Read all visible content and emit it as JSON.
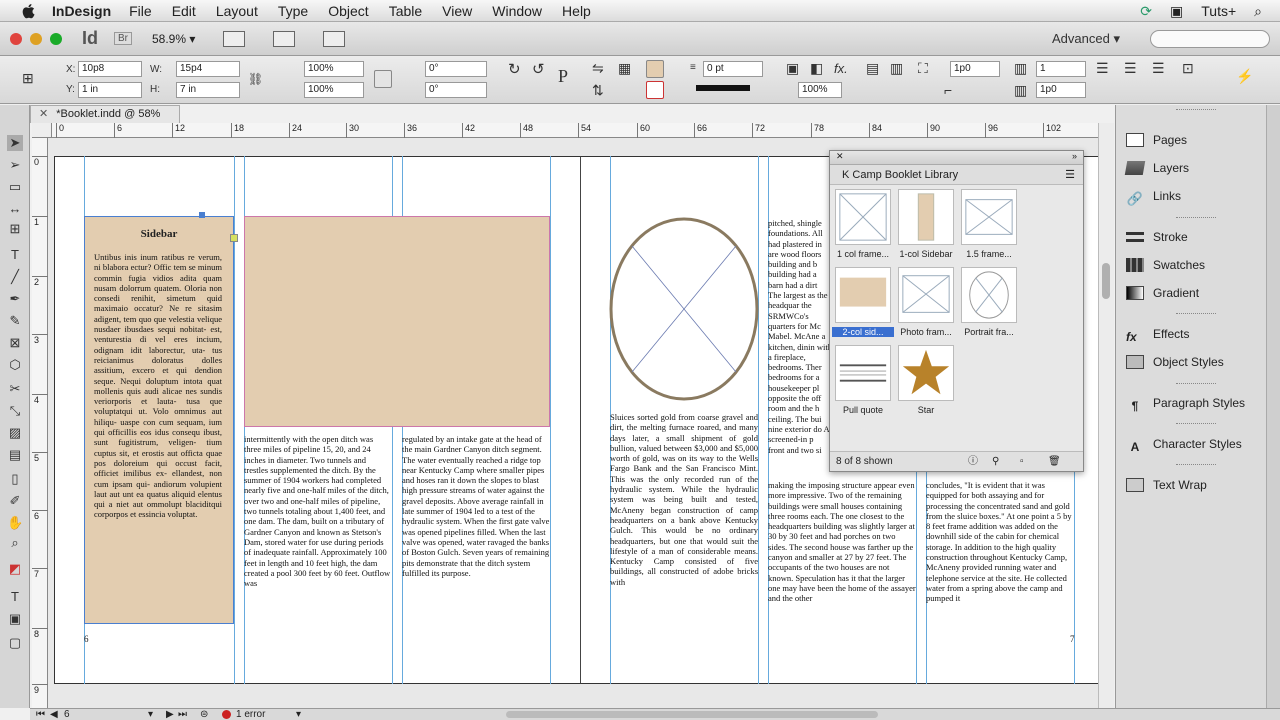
{
  "menubar": {
    "app_name": "InDesign",
    "items": [
      "File",
      "Edit",
      "Layout",
      "Type",
      "Object",
      "Table",
      "View",
      "Window",
      "Help"
    ],
    "right_label": "Tuts+"
  },
  "appbar": {
    "logo": "Id",
    "bridge": "Br",
    "zoom": "58.9%",
    "workspace": "Advanced"
  },
  "control": {
    "x": "10p8",
    "y": "1 in",
    "w": "15p4",
    "h": "7 in",
    "scale_x": "100%",
    "scale_y": "100%",
    "rotate": "0°",
    "shear": "0°",
    "stroke_weight": "0 pt",
    "opacity": "100%",
    "offset1": "1p0",
    "offset2": "1p0",
    "columns": "1"
  },
  "tab": {
    "title": "*Booklet.indd @ 58%"
  },
  "ruler": {
    "h_ticks": [
      "0",
      "6",
      "12",
      "18",
      "24",
      "30",
      "36",
      "42",
      "48",
      "54",
      "60",
      "66",
      "72",
      "78",
      "84",
      "90",
      "96",
      "102"
    ],
    "v_ticks": [
      "0",
      "1",
      "2",
      "3",
      "4",
      "5",
      "6",
      "7",
      "8",
      "9"
    ]
  },
  "document": {
    "sidebar_heading": "Sidebar",
    "sidebar_text": "Untibus inis inum ratibus re verum, ni blabora ectur? Offic tem se minum commin fugia vidios adita quam nusam dolorrum quatem. Oloria non consedi renihit, simetum quid maximaio occatur? Ne re sitasim adigent, tem quo que velestia velique nusdaer ibusdaes sequi nobitat- est, venturestia di vel eres incium, odignam idit laborectur, uta- tus reicianimus doloratus dolles assitium, excero et qui dendion seque. Nequi doluptum intota quat mollenis quis audi alicae nes sundis veriorporis et lauta- tusa que voluptatqui ut. Volo omnimus aut hiliqu- uaspe con cum sequam, ium qui officillis eos idus consequ ibust, sunt fugitistrum, veligen- tium cuptus sit, et erostis aut officta quae pos doloreium qui occust facit, officiet imilibus ex- ellandest, non cum ipsam qui- andiorum volupient laut aut unt ea quatus aliquid elentus qui a niet aut ommolupt blaciditqui corporpos et essincia voluptat.",
    "col1": "intermittently with the open ditch was three miles of pipeline 15, 20, and 24 inches in diameter. Two tunnels and trestles supplemented the ditch. By the summer of 1904 workers had completed nearly five and one-half miles of the ditch, over two and one-half miles of pipeline, two tunnels totaling about 1,400 feet, and one dam. The dam, built on a tributary of Gardner Canyon and known as Stetson's Dam, stored water for use during periods of inadequate rainfall. Approximately 100 feet in length and 10 feet high, the dam created a pool 300 feet by 60 feet. Outflow was",
    "col2": "regulated by an intake gate at the head of the main Gardner Canyon ditch segment. The water eventually reached a ridge top near Kentucky Camp where smaller pipes and hoses ran it down the slopes to blast high pressure streams of water against the gravel deposits. Above average rainfall in late summer of 1904 led to a test of the hydraulic system. When the first gate valve was opened pipelines filled. When the last valve was opened, water ravaged the banks of Boston Gulch. Seven years of remaining pits demonstrate that the ditch system fulfilled its purpose.",
    "col3": "Sluices sorted gold from coarse gravel and dirt, the melting furnace roared, and many days later, a small shipment of gold bullion, valued between $3,000 and $5,000 worth of gold, was on its way to the Wells Fargo Bank and the San Francisco Mint. This was the only recorded run of the hydraulic system. While the hydraulic system was being built and tested, McAneny began construction of camp headquarters on a bank above Kentucky Gulch. This would be no ordinary headquarters, but one that would suit the lifestyle of a man of considerable means. Kentucky Camp consisted of five buildings, all constructed of adobe bricks with",
    "col4_top": "pitched, shingle foundations. All had plastered in are wood floors building and b building had a barn had a dirt The largest as the headquar the SRMWCo's quarters for Mc Mabel. McAne a kitchen, dinin with a fireplace, bedrooms. Ther bedrooms for a housekeeper pl opposite the off room and the h ceiling. The bui nine exterior do A screened-in p front and two si",
    "col4_bottom": "making the imposing structure appear even more impressive. Two of the remaining buildings were small houses containing three rooms each. The one closest to the headquarters building was slightly larger at 30 by 30 feet and had porches on two sides. The second house was farther up the canyon and smaller at 27 by 27 feet. The occupants of the two houses are not known. Speculation has it that the larger one may have been the home of the assayer and the other",
    "col5": "concludes, \"It is evident that it was equipped for both assaying and for processing the concentrated sand and gold from the sluice boxes.\" At one point a 5 by 8 feet frame addition was added on the downhill side of the cabin for chemical storage. In addition to the high quality construction throughout Kentucky Camp, McAneny provided running water and telephone service at the site. He collected water from a spring above the camp and pumped it",
    "page_num_left": "6",
    "page_num_right": "7"
  },
  "library": {
    "title": "K Camp Booklet Library",
    "items": [
      {
        "label": "1 col frame..."
      },
      {
        "label": "1-col Sidebar"
      },
      {
        "label": "1.5 frame..."
      },
      {
        "label": "2-col sid..."
      },
      {
        "label": "Photo fram..."
      },
      {
        "label": "Portrait fra..."
      },
      {
        "label": "Pull quote"
      },
      {
        "label": "Star"
      }
    ],
    "count": "8 of 8 shown"
  },
  "panels": {
    "items": [
      "Pages",
      "Layers",
      "Links",
      "Stroke",
      "Swatches",
      "Gradient",
      "Effects",
      "Object Styles",
      "Paragraph Styles",
      "Character Styles",
      "Text Wrap"
    ]
  },
  "status": {
    "page": "6",
    "errors": "1 error"
  },
  "colors": {
    "accent_tan": "#e3cdb0",
    "star_gold": "#b8822a",
    "guide_cyan": "#66aadd",
    "margin_magenta": "#cc88bb",
    "error_red": "#cc2222"
  }
}
